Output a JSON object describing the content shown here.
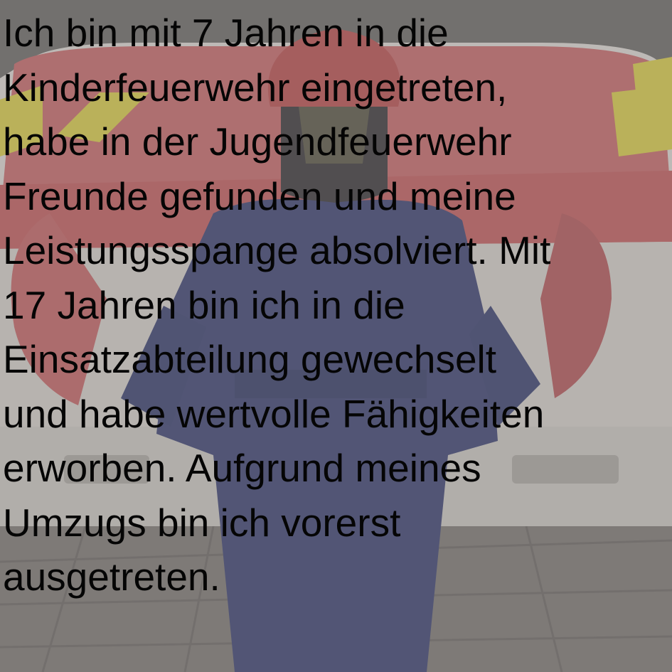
{
  "caption": {
    "lines": [
      "Ich bin mit 7 Jahren in die",
      "Kinderfeuerwehr eingetreten,",
      "habe in der Jugendfeuerwehr",
      "Freunde gefunden und meine",
      "Leistungsspange absolviert. Mit",
      "17 Jahren bin ich in die",
      "Einsatzabteilung gewechselt",
      "und habe wertvolle Fähigkeiten",
      "erworben. Aufgrund meines",
      "Umzugs bin ich vorerst",
      "ausgetreten."
    ]
  }
}
